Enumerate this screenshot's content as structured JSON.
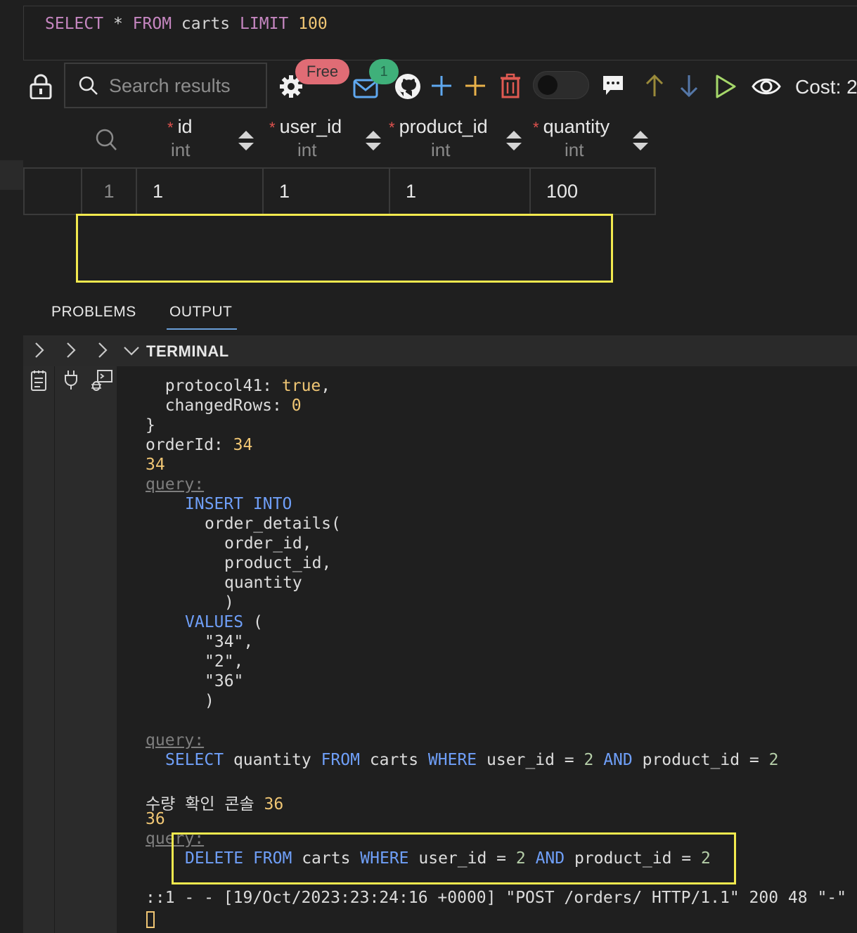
{
  "query_editor": {
    "kw_select": "SELECT",
    "star": "*",
    "kw_from": "FROM",
    "table": "carts",
    "kw_limit": "LIMIT",
    "limit_value": "100"
  },
  "toolbar": {
    "search_placeholder": "Search results",
    "free_badge": "Free",
    "mail_count": "1",
    "cost_label": "Cost: 2"
  },
  "grid": {
    "columns": [
      {
        "name": "id",
        "type": "int"
      },
      {
        "name": "user_id",
        "type": "int"
      },
      {
        "name": "product_id",
        "type": "int"
      },
      {
        "name": "quantity",
        "type": "int"
      }
    ],
    "rows": [
      {
        "row_no": "1",
        "id": "1",
        "user_id": "1",
        "product_id": "1",
        "quantity": "100"
      }
    ]
  },
  "panel_tabs": [
    "PROBLEMS",
    "OUTPUT"
  ],
  "terminal": {
    "title": "TERMINAL",
    "l1_key": "protocol41: ",
    "l1_val": "true",
    "l1_end": ",",
    "l2_key": "changedRows: ",
    "l2_val": "0",
    "l3": "}",
    "l4_key": "orderId: ",
    "l4_val": "34",
    "l5": "34",
    "query_label": "query:",
    "l7": "INSERT INTO",
    "l8": "order_details(",
    "l9": "order_id,",
    "l10": "product_id,",
    "l11": "quantity",
    "l12": ")",
    "l13_kw": "VALUES",
    "l13_rest": " (",
    "l14": "\"34\",",
    "l15": "\"2\",",
    "l16": "\"36\"",
    "l17": ")",
    "select_kw": "SELECT",
    "select_col": " quantity ",
    "from_kw": "FROM",
    "from_tbl": " carts ",
    "where_kw": "WHERE",
    "cond1": " user_id = ",
    "cond1_val": "2",
    "and_kw": "AND",
    "cond2": " product_id = ",
    "cond2_val": "2",
    "korean_label": "수량 확인 콘솔 ",
    "korean_val": "36",
    "l22": "36",
    "delete_kw": "DELETE",
    "delete_from": "FROM",
    "log_line": "::1 - - [19/Oct/2023:23:24:16 +0000] \"POST /orders/ HTTP/1.1\" 200 48 \"-\""
  }
}
